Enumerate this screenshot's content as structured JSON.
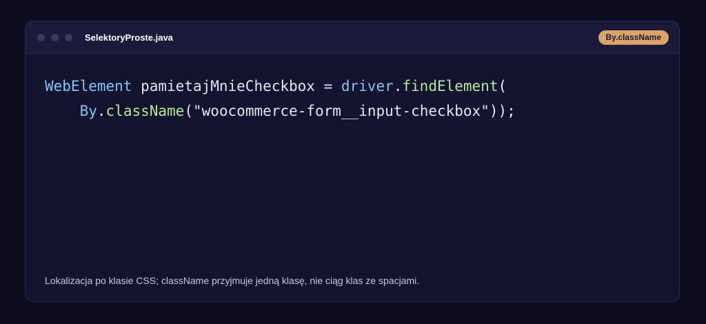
{
  "window": {
    "filename": "SelektoryProste.java",
    "badge": "By.className"
  },
  "code": {
    "line1": {
      "type": "WebElement",
      "var": " pamietajMnieCheckbox = ",
      "obj": "driver",
      "dot": ".",
      "method": "findElement",
      "open": "("
    },
    "line2": {
      "indent": "    ",
      "cls": "By",
      "dot": ".",
      "method": "className",
      "args": "(\"woocommerce-form__input-checkbox\"));"
    }
  },
  "caption": "Lokalizacja po klasie CSS; className przyjmuje jedną klasę, nie ciąg klas ze spacjami.",
  "colors": {
    "background": "#0d0c21",
    "panel": "#141330",
    "titlebar": "#1b1a3b",
    "badge": "#dba36c",
    "keyword_type": "#89c4f4",
    "method": "#b7e89a"
  }
}
